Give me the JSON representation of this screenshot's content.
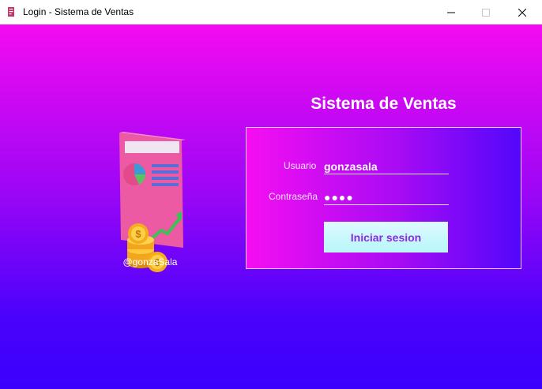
{
  "window": {
    "title": "Login - Sistema de Ventas",
    "controls": [
      "minimize",
      "maximize",
      "close"
    ]
  },
  "main": {
    "heading": "Sistema de Ventas",
    "illustration_icon": "sales-report-coins-icon",
    "credit": "@gonzaSala"
  },
  "login": {
    "usuario_label": "Usuario",
    "usuario_value": "gonzasala",
    "password_label": "Contraseña",
    "password_value": "●●●●",
    "button_label": "Iniciar sesion"
  },
  "colors": {
    "gradient_top": "#f40bf0",
    "gradient_bottom": "#3a00fc",
    "button_bg": "#c8f7fb",
    "button_text": "#8a2be2"
  }
}
